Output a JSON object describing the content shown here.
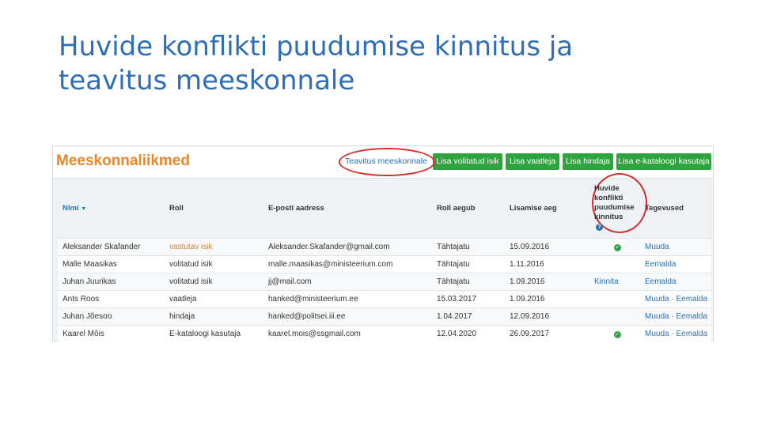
{
  "slide": {
    "title_line1": "Huvide konflikti puudumise kinnitus ja",
    "title_line2": "teavitus meeskonnale"
  },
  "panel": {
    "title": "Meeskonnaliikmed",
    "buttons": [
      {
        "label": "Teavitus meeskonnale",
        "style": "plain",
        "circled": true
      },
      {
        "label": "Lisa volitatud isik",
        "style": "primary"
      },
      {
        "label": "Lisa vaatleja",
        "style": "primary"
      },
      {
        "label": "Lisa hindaja",
        "style": "primary"
      },
      {
        "label": "Lisa e-kataloogi kasutaja",
        "style": "primary"
      }
    ]
  },
  "table": {
    "columns": {
      "name": "Nimi",
      "role": "Roll",
      "email": "E-posti aadress",
      "expires": "Roll aegub",
      "added": "Lisamise aeg",
      "coi_lines": [
        "Huvide",
        "konflikti",
        "puudumise",
        "kinnitus"
      ],
      "actions": "Tegevused"
    },
    "sort_icon": "caret-down-icon",
    "help_icon": "question-circle-icon",
    "check_icon": "check-circle-icon",
    "action_separator": "·",
    "rows": [
      {
        "name": "Aleksander Skafander",
        "role": "vastutav isik",
        "email": "Aleksander.Skafander@gmail.com",
        "expires": "Tähtajatu",
        "added": "15.09.2016",
        "coi": "check",
        "actions": [
          "Muuda"
        ]
      },
      {
        "name": "Malle Maasikas",
        "role": "volitatud isik",
        "email": "malle.maasikas@ministeerium.com",
        "expires": "Tähtajatu",
        "added": "1.11.2016",
        "coi": "",
        "actions": [
          "Eemalda"
        ]
      },
      {
        "name": "Juhan Juurikas",
        "role": "volitatud isik",
        "email": "jj@mail.com",
        "expires": "Tähtajatu",
        "added": "1.09.2016",
        "coi": "Kinnita",
        "actions": [
          "Eemalda"
        ]
      },
      {
        "name": "Ants Roos",
        "role": "vaatleja",
        "email": "hanked@ministeerium.ee",
        "expires": "15.03.2017",
        "added": "1.09.2016",
        "coi": "",
        "actions": [
          "Muuda",
          "Eemalda"
        ]
      },
      {
        "name": "Juhan Jõesoo",
        "role": "hindaja",
        "email": "hanked@politsei.iii.ee",
        "expires": "1.04.2017",
        "added": "12.09.2016",
        "coi": "",
        "actions": [
          "Muuda",
          "Eemalda"
        ]
      },
      {
        "name": "Kaarel Mõis",
        "role": "E-kataloogi kasutaja",
        "email": "kaarel.mois@ssgmail.com",
        "expires": "12.04.2020",
        "added": "26.09.2017",
        "coi": "check",
        "actions": [
          "Muuda",
          "Eemalda"
        ]
      }
    ]
  }
}
